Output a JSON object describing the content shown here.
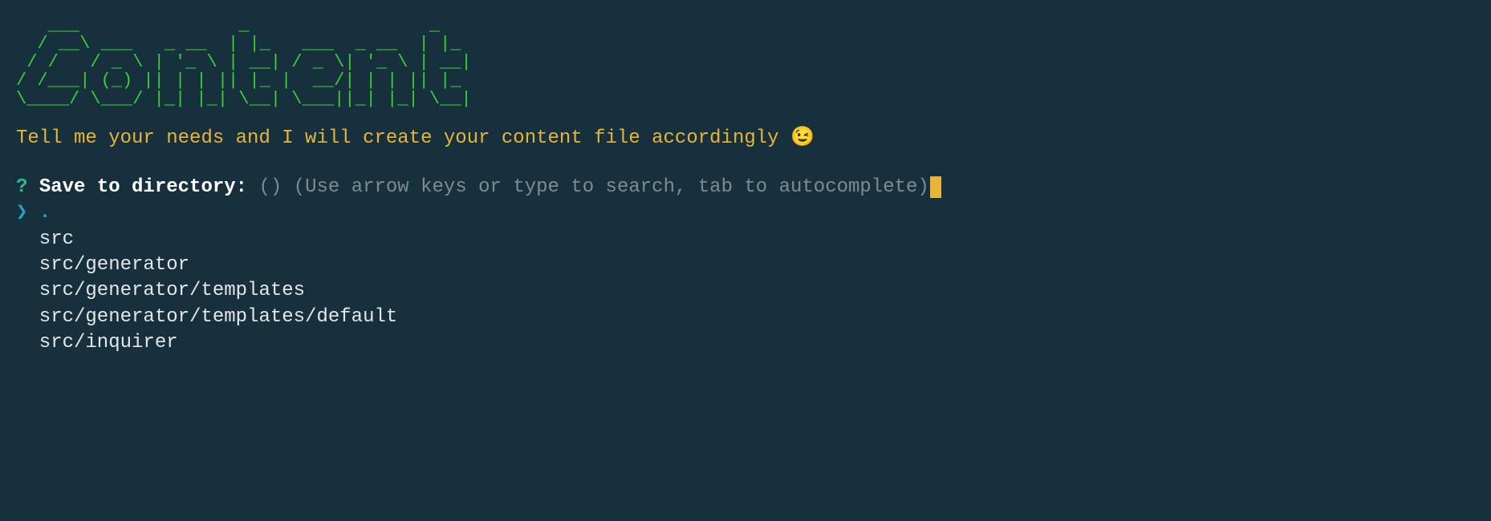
{
  "banner": "   ___               _                 _   \n  / __\\ ___   _ __  | |_   ___  _ __  | |_ \n / /   / _ \\ | '_ \\ | __| / _ \\| '_ \\ | __|\n/ /___| (_) || | | || |_ |  __/| | | || |_ \n\\____/ \\___/ |_| |_| \\__| \\___||_| |_| \\__|",
  "intro": "Tell me your needs and I will create your content file accordingly 😉",
  "prompt": {
    "marker": "?",
    "label": "Save to directory:",
    "default": "()",
    "hint": "(Use arrow keys or type to search, tab to autocomplete)"
  },
  "options": {
    "pointer": "❯",
    "selectedIndex": 0,
    "items": [
      ".",
      "src",
      "src/generator",
      "src/generator/templates",
      "src/generator/templates/default",
      "src/inquirer"
    ]
  }
}
